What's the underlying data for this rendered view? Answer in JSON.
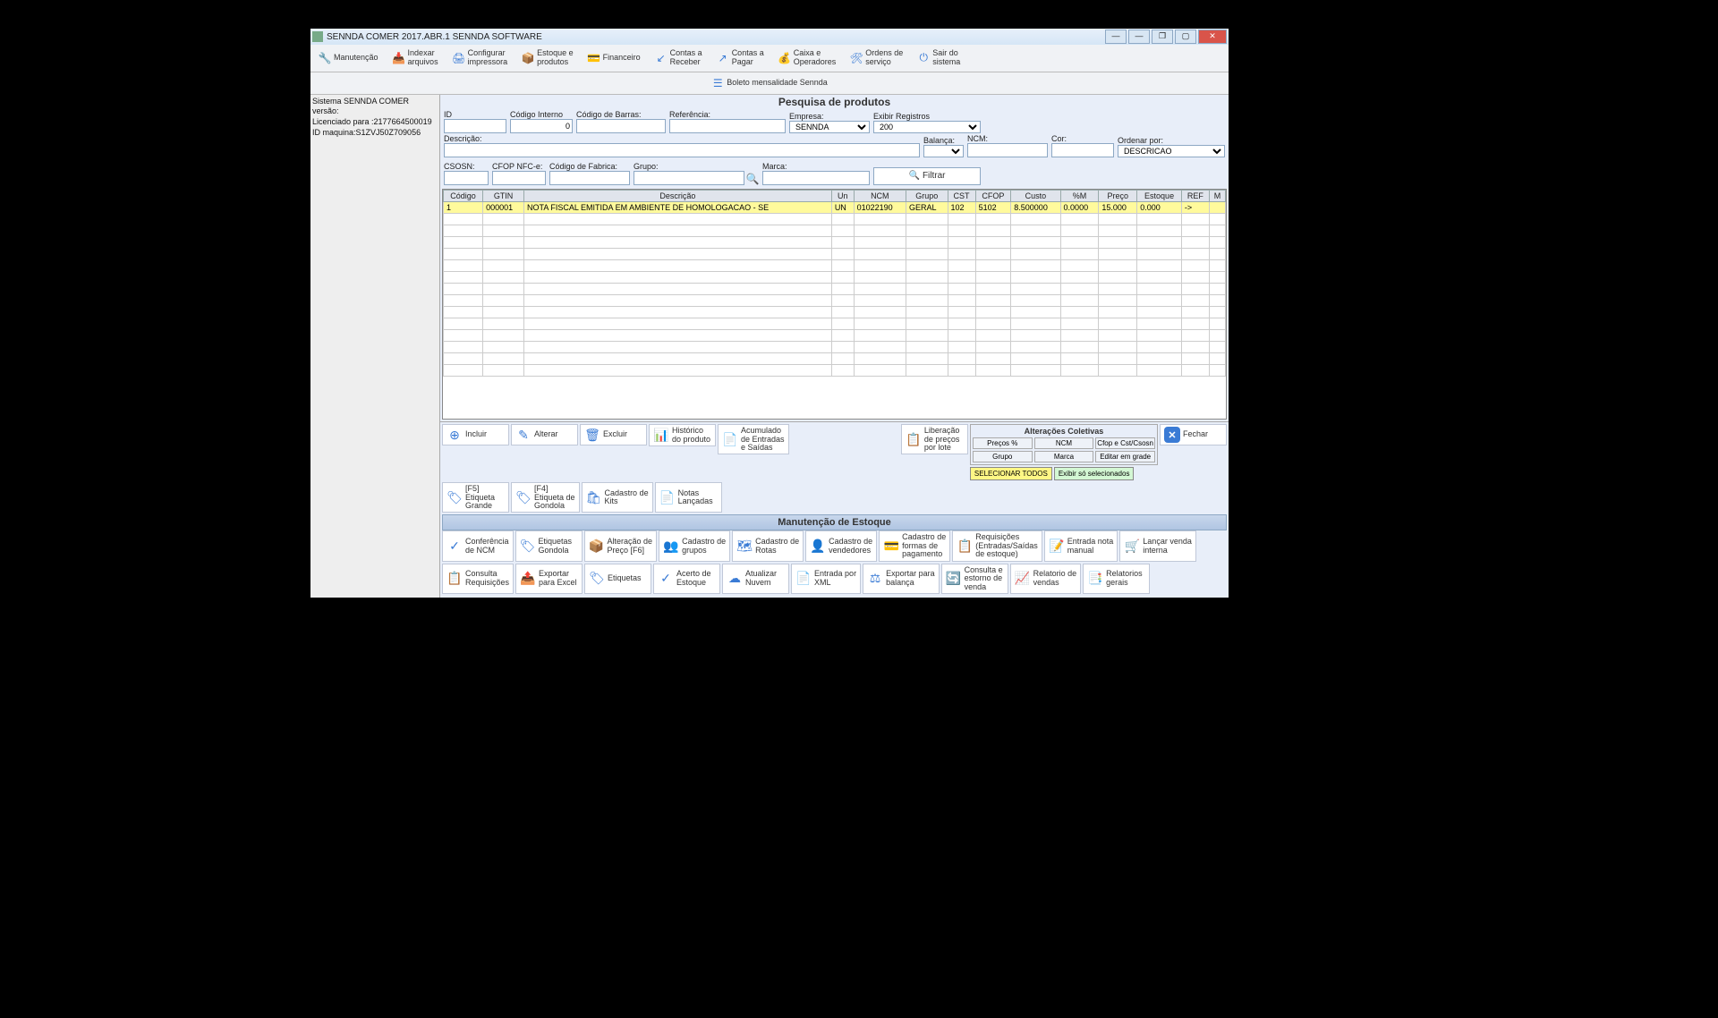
{
  "window_title": "SENNDA COMER 2017.ABR.1   SENNDA SOFTWARE",
  "toolbar": [
    {
      "icon": "🔧",
      "label": "Manutenção"
    },
    {
      "icon": "📥",
      "label": "Indexar\narquivos"
    },
    {
      "icon": "🖨",
      "label": "Configurar\nimpressora"
    },
    {
      "icon": "📦",
      "label": "Estoque e\nprodutos"
    },
    {
      "icon": "💳",
      "label": "Financeiro"
    },
    {
      "icon": "↙",
      "label": "Contas a\nReceber"
    },
    {
      "icon": "↗",
      "label": "Contas a\nPagar"
    },
    {
      "icon": "💰",
      "label": "Caixa e\nOperadores"
    },
    {
      "icon": "🛠",
      "label": "Ordens de\nserviço"
    },
    {
      "icon": "⏻",
      "label": "Sair do\nsistema"
    }
  ],
  "secondary_bar_label": "Boleto mensalidade Sennda",
  "sidebar": {
    "l1": "Sistema SENNDA COMER versão:",
    "l2": "Licenciado para :2177664500019",
    "l3": "ID maquina:S1ZVJ50Z709056"
  },
  "search_title": "Pesquisa de produtos",
  "labels": {
    "id": "ID",
    "codigo_interno": "Código Interno",
    "codigo_barras": "Código de Barras:",
    "referencia": "Referência:",
    "empresa": "Empresa:",
    "exibir": "Exibir Registros",
    "descricao": "Descrição:",
    "balanca": "Balança:",
    "ncm": "NCM:",
    "cor": "Cor:",
    "ordenar": "Ordenar por:",
    "csosn": "CSOSN:",
    "cfop_nfce": "CFOP NFC-e:",
    "codigo_fabrica": "Código de Fabrica:",
    "grupo": "Grupo:",
    "marca": "Marca:",
    "filtrar": "Filtrar"
  },
  "values": {
    "codigo_interno": "0",
    "empresa": "SENNDA",
    "exibir": "200",
    "ordenar": "DESCRICAO"
  },
  "grid_headers": [
    "Código",
    "GTIN",
    "Descrição",
    "Un",
    "NCM",
    "Grupo",
    "CST",
    "CFOP",
    "Custo",
    "%M",
    "Preço",
    "Estoque",
    "REF",
    "M"
  ],
  "grid_rows": [
    {
      "codigo": "1",
      "gtin": "000001",
      "descricao": "NOTA FISCAL EMITIDA EM AMBIENTE DE HOMOLOGACAO - SE",
      "un": "UN",
      "ncm": "01022190",
      "grupo": "GERAL",
      "cst": "102",
      "cfop": "5102",
      "custo": "8.500000",
      "pm": "0.0000",
      "preco": "15.000",
      "estoque": "0.000",
      "ref": "->",
      "m": ""
    }
  ],
  "actions_row1": [
    {
      "icon": "⊕",
      "label": "Incluir"
    },
    {
      "icon": "✎",
      "label": "Alterar"
    },
    {
      "icon": "🗑",
      "label": "Excluir"
    },
    {
      "icon": "📊",
      "label": "Histórico\ndo produto"
    },
    {
      "icon": "📄",
      "label": "Acumulado\nde Entradas\ne Saídas"
    }
  ],
  "liberacao": {
    "icon": "📋",
    "label": "Liberação\nde preços\npor lote"
  },
  "fechar_label": "Fechar",
  "alter_title": "Alterações Coletivas",
  "alter_buttons": [
    "Preços %",
    "NCM",
    "Cfop e Cst/Csosn",
    "Grupo",
    "Marca",
    "Editar em grade"
  ],
  "sel_all": "SELECIONAR TODOS",
  "sel_only": "Exibir só selecionados",
  "actions_row2": [
    {
      "icon": "🏷",
      "label": "[F5]\nEtiqueta\nGrande"
    },
    {
      "icon": "🏷",
      "label": "[F4]\nEtiqueta de\nGondola"
    },
    {
      "icon": "🛍",
      "label": "Cadastro de\nKits"
    },
    {
      "icon": "📄",
      "label": "Notas\nLançadas"
    }
  ],
  "stock_header": "Manutenção de Estoque",
  "actions_row3": [
    {
      "icon": "✓",
      "label": "Conferência\nde NCM"
    },
    {
      "icon": "🏷",
      "label": "Etiquetas\nGondola"
    },
    {
      "icon": "📦",
      "label": "Alteração de\nPreço [F6]"
    },
    {
      "icon": "👥",
      "label": "Cadastro de\ngrupos"
    },
    {
      "icon": "🗺",
      "label": "Cadastro de\nRotas"
    },
    {
      "icon": "👤",
      "label": "Cadastro de\nvendedores"
    },
    {
      "icon": "💳",
      "label": "Cadastro de\nformas de\npagamento"
    },
    {
      "icon": "📋",
      "label": "Requisições\n(Entradas/Saídas\nde estoque)"
    },
    {
      "icon": "📝",
      "label": "Entrada nota\nmanual"
    },
    {
      "icon": "🛒",
      "label": "Lançar venda\ninterna"
    }
  ],
  "actions_row4": [
    {
      "icon": "📋",
      "label": "Consulta\nRequisições"
    },
    {
      "icon": "📤",
      "label": "Exportar\npara Excel"
    },
    {
      "icon": "🏷",
      "label": "Etiquetas"
    },
    {
      "icon": "✓",
      "label": "Acerto de\nEstoque"
    },
    {
      "icon": "☁",
      "label": "Atualizar\nNuvem"
    },
    {
      "icon": "📄",
      "label": "Entrada por\nXML"
    },
    {
      "icon": "⚖",
      "label": "Exportar para\nbalança"
    },
    {
      "icon": "🔄",
      "label": "Consulta e\nestorno de\nvenda"
    },
    {
      "icon": "📈",
      "label": "Relatorio de\nvendas"
    },
    {
      "icon": "📑",
      "label": "Relatorios\ngerais"
    }
  ]
}
